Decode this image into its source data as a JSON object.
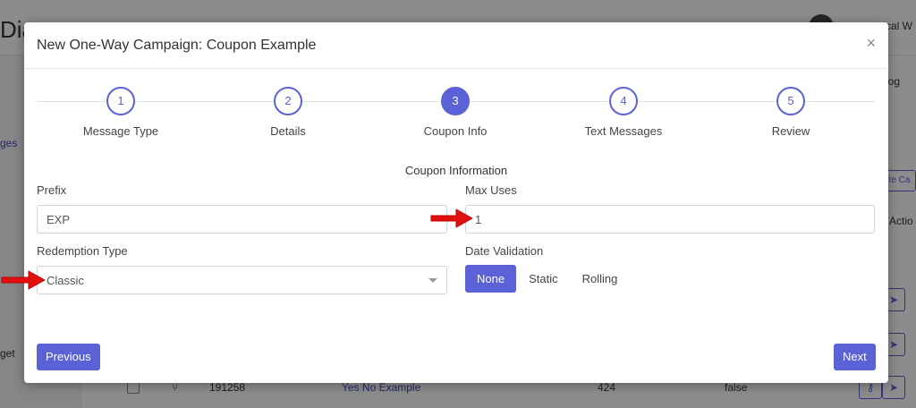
{
  "background": {
    "logo_fragment": "Dia",
    "user_fragment": "ical W",
    "nav_fragment": "ges",
    "nav_fragment2": "get",
    "right_link_fragment": "log",
    "button_fragment": "ate Ca",
    "action_fragment": "Actio",
    "row": {
      "id": "191258",
      "name": "Yes No Example",
      "count": "424",
      "flag": "false"
    }
  },
  "modal": {
    "title": "New One-Way Campaign: Coupon Example",
    "close_glyph": "×"
  },
  "stepper": {
    "steps": [
      {
        "number": "1",
        "label": "Message Type"
      },
      {
        "number": "2",
        "label": "Details"
      },
      {
        "number": "3",
        "label": "Coupon Info",
        "active": true
      },
      {
        "number": "4",
        "label": "Text Messages"
      },
      {
        "number": "5",
        "label": "Review"
      }
    ]
  },
  "form": {
    "section_title": "Coupon Information",
    "prefix": {
      "label": "Prefix",
      "value": "EXP"
    },
    "max_uses": {
      "label": "Max Uses",
      "value": "1"
    },
    "redemption_type": {
      "label": "Redemption Type",
      "value": "Classic"
    },
    "date_validation": {
      "label": "Date Validation",
      "options": [
        "None",
        "Static",
        "Rolling"
      ],
      "selected": "None"
    }
  },
  "footer": {
    "previous_label": "Previous",
    "next_label": "Next"
  },
  "colors": {
    "accent": "#5a62d6",
    "annotation_arrow": "#e01010"
  }
}
